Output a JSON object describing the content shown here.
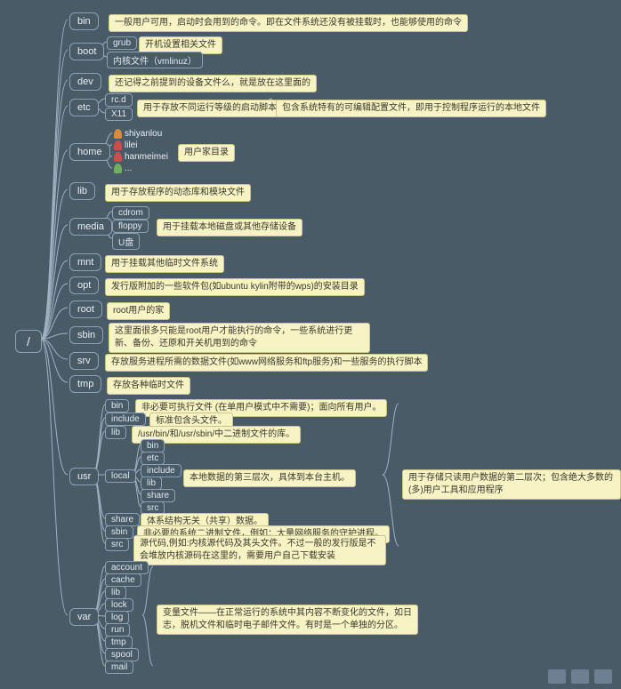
{
  "root": {
    "label": "/"
  },
  "level1": {
    "bin": {
      "label": "bin",
      "note": "一般用户可用，启动时会用到的命令。即在文件系统还没有被挂载时，也能够使用的命令"
    },
    "boot": {
      "label": "boot",
      "children": {
        "grub": {
          "label": "grub",
          "note": "开机设置相关文件"
        },
        "vmlinuz": {
          "label": "内核文件（vmlinuz）"
        }
      }
    },
    "dev": {
      "label": "dev",
      "note": "还记得之前提到的设备文件么，就是放在这里面的"
    },
    "etc": {
      "label": "etc",
      "children": {
        "rcd": {
          "label": "rc.d"
        },
        "x11": {
          "label": "X11"
        }
      },
      "note1": "用于存放不同运行等级的启动脚本的链接文件",
      "note2": "包含系统特有的可编辑配置文件，即用于控制程序运行的本地文件"
    },
    "home": {
      "label": "home",
      "users": {
        "u1": "shiyanlou",
        "u2": "lilei",
        "u3": "hanmeimei",
        "u4": "..."
      },
      "note": "用户家目录"
    },
    "lib": {
      "label": "lib",
      "note": "用于存放程序的动态库和模块文件"
    },
    "media": {
      "label": "media",
      "children": {
        "cdrom": "cdrom",
        "floppy": "floppy",
        "udisk": "U盘"
      },
      "note": "用于挂载本地磁盘或其他存储设备"
    },
    "mnt": {
      "label": "mnt",
      "note": "用于挂载其他临时文件系统"
    },
    "opt": {
      "label": "opt",
      "note": "发行版附加的一些软件包(如ubuntu kylin附带的wps)的安装目录"
    },
    "root": {
      "label": "root",
      "note": "root用户的家"
    },
    "sbin": {
      "label": "sbin",
      "note": "这里面很多只能是root用户才能执行的命令，一些系统进行更新、备份、还原和开关机用到的命令"
    },
    "srv": {
      "label": "srv",
      "note": "存放服务进程所需的数据文件(如www网络服务和ftp服务)和一些服务的执行脚本"
    },
    "tmp": {
      "label": "tmp",
      "note": "存放各种临时文件"
    },
    "usr": {
      "label": "usr",
      "note_outer": "用于存储只读用户数据的第二层次；包含绝大多数的(多)用户工具和应用程序",
      "children": {
        "bin": {
          "label": "bin",
          "note": "非必要可执行文件 (在单用户模式中不需要)；面向所有用户。"
        },
        "include": {
          "label": "include",
          "note": "标准包含头文件。"
        },
        "lib": {
          "label": "lib",
          "note": "/usr/bin/和/usr/sbin/中二进制文件的库。"
        },
        "local": {
          "label": "local",
          "note": "本地数据的第三层次，具体到本台主机。",
          "children": {
            "bin": "bin",
            "etc": "etc",
            "include": "include",
            "lib": "lib",
            "share": "share",
            "src": "src"
          }
        },
        "share": {
          "label": "share",
          "note": "体系结构无关（共享）数据。"
        },
        "sbin": {
          "label": "sbin",
          "note": "非必要的系统二进制文件，例如：大量网络服务的守护进程。"
        },
        "src": {
          "label": "src",
          "note": "源代码,例如:内核源代码及其头文件。不过一般的发行版是不会堆放内核源码在这里的，需要用户自己下载安装"
        }
      }
    },
    "var": {
      "label": "var",
      "note": "变量文件——在正常运行的系统中其内容不断变化的文件，如日志，脱机文件和临时电子邮件文件。有时是一个单独的分区。",
      "children": {
        "account": "account",
        "cache": "cache",
        "lib": "lib",
        "lock": "lock",
        "log": "log",
        "run": "run",
        "tmp": "tmp",
        "spool": "spool",
        "mail": "mail"
      }
    }
  }
}
